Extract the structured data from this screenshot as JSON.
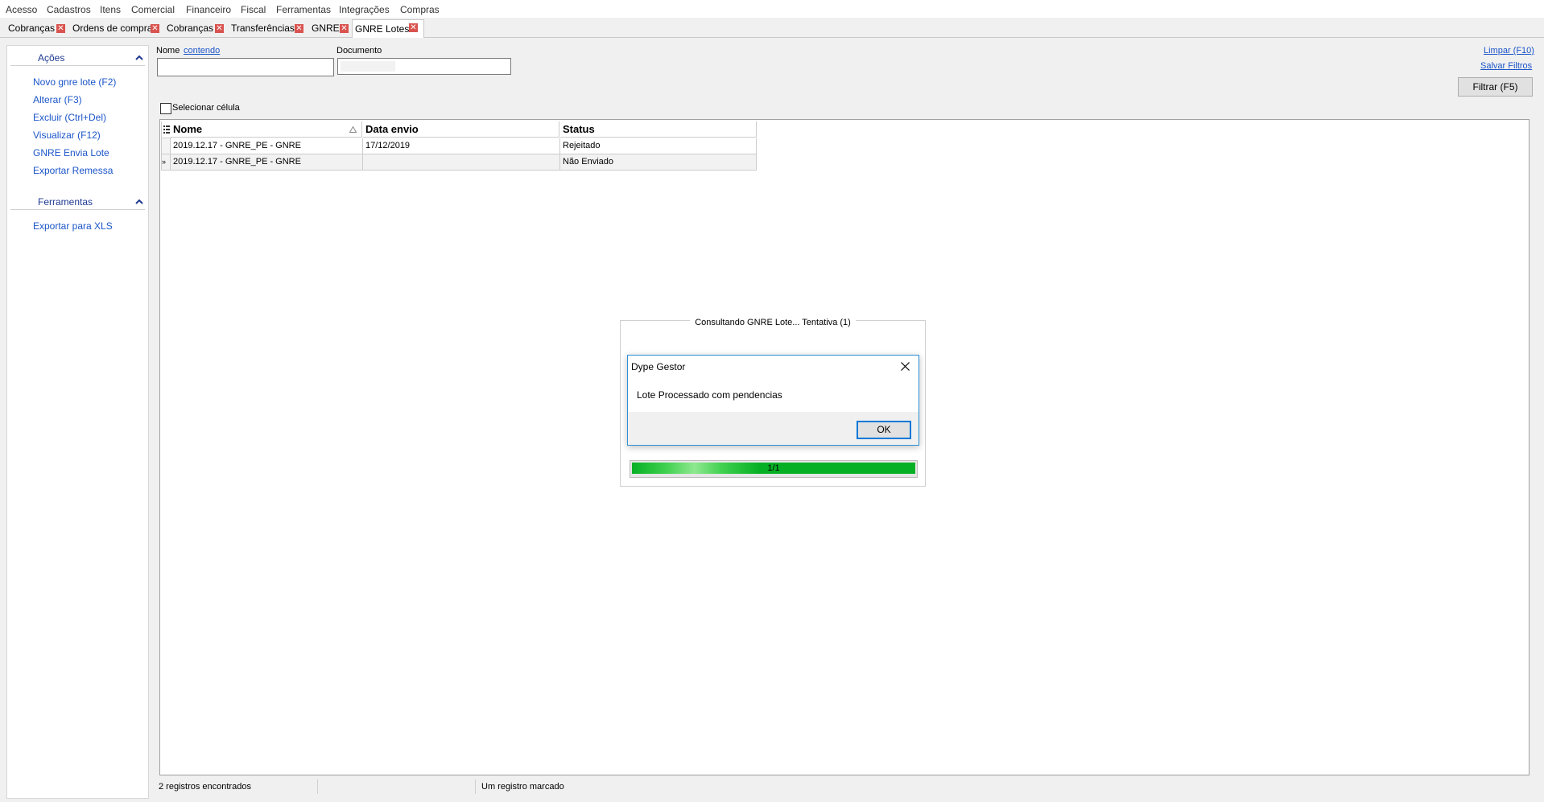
{
  "menu": [
    "Acesso",
    "Cadastros",
    "Itens",
    "Comercial",
    "Financeiro",
    "Fiscal",
    "Ferramentas",
    "Integrações",
    "Compras"
  ],
  "tabs": [
    {
      "label": "Cobranças",
      "closable": true
    },
    {
      "label": "Ordens de compra",
      "closable": true
    },
    {
      "label": "Cobranças",
      "closable": true
    },
    {
      "label": "Transferências",
      "closable": true
    },
    {
      "label": "GNRE",
      "closable": true
    },
    {
      "label": "GNRE Lotes",
      "closable": true,
      "active": true
    }
  ],
  "sidebar": {
    "acoes_title": "Ações",
    "acoes": [
      "Novo gnre lote (F2)",
      "Alterar (F3)",
      "Excluir (Ctrl+Del)",
      "Visualizar (F12)",
      "GNRE Envia Lote",
      "Exportar Remessa"
    ],
    "ferramentas_title": "Ferramentas",
    "ferramentas": [
      "Exportar para XLS"
    ]
  },
  "filters": {
    "nome_label": "Nome",
    "nome_mode": "contendo",
    "nome_value": "",
    "documento_label": "Documento",
    "documento_value": "",
    "limpar": "Limpar (F10)",
    "salvar": "Salvar Filtros",
    "filtrar": "Filtrar (F5)"
  },
  "grid": {
    "select_cell_label": "Selecionar célula",
    "columns": [
      "Nome",
      "Data envio",
      "Status"
    ],
    "rows": [
      {
        "nome": "2019.12.17 - GNRE_PE - GNRE",
        "data": "17/12/2019",
        "status": "Rejeitado"
      },
      {
        "nome": "2019.12.17 - GNRE_PE - GNRE",
        "data": "",
        "status": "Não Enviado"
      }
    ]
  },
  "status": {
    "count": "2 registros encontrados",
    "marked": "Um registro marcado"
  },
  "progress": {
    "title": "Consultando GNRE Lote... Tentativa (1)",
    "text": "1/1",
    "fraction": 1.0
  },
  "dialog": {
    "title": "Dype Gestor",
    "message": "Lote Processado com pendencias",
    "ok": "OK"
  }
}
